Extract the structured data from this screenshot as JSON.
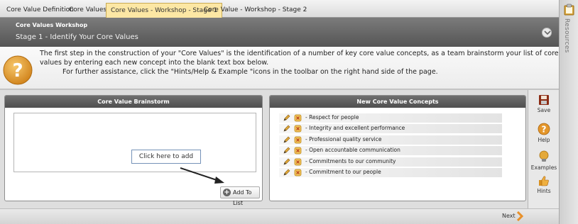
{
  "tabs": [
    {
      "label": "Core Value Definition",
      "active": false
    },
    {
      "label": "Core Values",
      "active": false
    },
    {
      "label": "Core Values - Workshop - Stage 1",
      "active": true
    },
    {
      "label": "Core Value - Workshop - Stage 2",
      "active": false
    }
  ],
  "resources": {
    "label": "Resources",
    "icon": "clipboard-icon"
  },
  "header": {
    "workshop_title": "Core Values Workshop",
    "stage_title": "Stage 1 - Identify Your Core Values"
  },
  "info": {
    "icon": "question-mark-icon",
    "line1": "The first step in the construction of your \"Core Values\" is the identification of a number of key core value concepts, as a team brainstorm your list of core",
    "line2": "values by entering each new concept into the blank text box below.",
    "line3": "For further assistance, click the \"Hints/Help & Example \"icons in the toolbar on the right hand side of the page."
  },
  "brainstorm": {
    "title": "Core Value Brainstorm",
    "callout": "Click here to add",
    "add_button": "Add To List"
  },
  "concepts": {
    "title": "New Core Value Concepts",
    "items": [
      "- Respect for people",
      "- Integrity and excellent performance",
      "- Professional quality service",
      "- Open accountable communication",
      "- Commitments to our community",
      "- Commitment to our people"
    ]
  },
  "toolbar": {
    "save": "Save",
    "help": "Help",
    "examples": "Examples",
    "hints": "Hints"
  },
  "footer": {
    "next": "Next"
  },
  "colors": {
    "active_tab": "#fce7a4",
    "header_dark": "#5e5e5e",
    "accent_orange": "#e8902a"
  }
}
